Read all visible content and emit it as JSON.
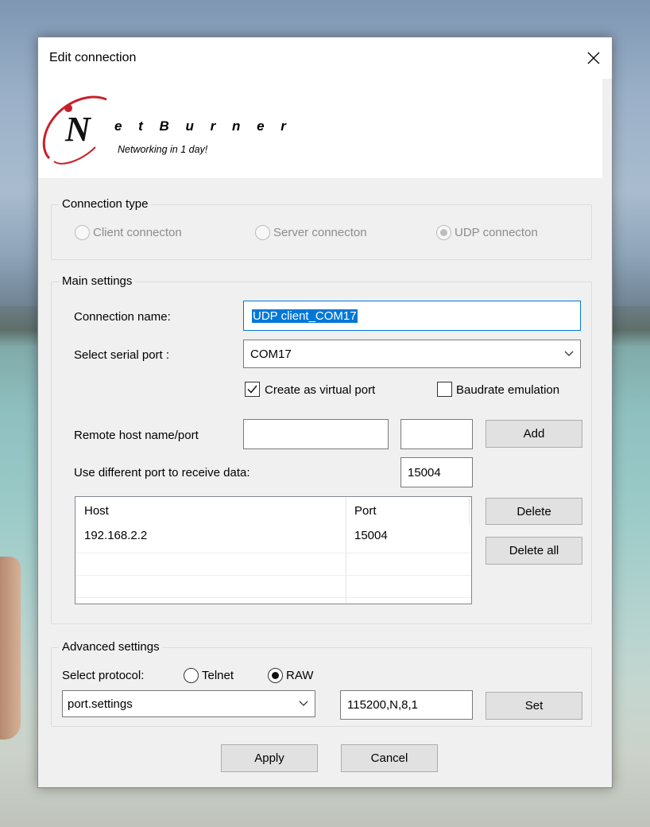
{
  "dialog": {
    "title": "Edit connection",
    "logo": {
      "wordmark": "e t B u r n e r",
      "letter": "N",
      "tagline": "Networking in 1 day!"
    }
  },
  "connection_type": {
    "legend": "Connection type",
    "options": [
      {
        "label": "Client connecton",
        "selected": false,
        "enabled": false
      },
      {
        "label": "Server connecton",
        "selected": false,
        "enabled": false
      },
      {
        "label": "UDP connecton",
        "selected": true,
        "enabled": false
      }
    ]
  },
  "main_settings": {
    "legend": "Main settings",
    "connection_name_label": "Connection name:",
    "connection_name_value": "UDP client_COM17",
    "serial_port_label": "Select serial port :",
    "serial_port_value": "COM17",
    "virtual_port_label": "Create as virtual port",
    "virtual_port_checked": true,
    "baudrate_label": "Baudrate emulation",
    "baudrate_checked": false,
    "remote_host_label": "Remote host name/port",
    "remote_host_value": "",
    "remote_port_value": "",
    "add_label": "Add",
    "diff_port_label": "Use different port to receive data:",
    "diff_port_value": "15004",
    "table": {
      "headers": [
        "Host",
        "Port"
      ],
      "rows": [
        [
          "192.168.2.2",
          "15004"
        ]
      ]
    },
    "delete_label": "Delete",
    "delete_all_label": "Delete all"
  },
  "advanced_settings": {
    "legend": "Advanced settings",
    "protocol_label": "Select protocol:",
    "protocols": [
      {
        "label": "Telnet",
        "selected": false
      },
      {
        "label": "RAW",
        "selected": true
      }
    ],
    "settings_combo_value": "port.settings",
    "settings_value": "115200,N,8,1",
    "set_label": "Set"
  },
  "footer": {
    "apply_label": "Apply",
    "cancel_label": "Cancel"
  },
  "colors": {
    "accent": "#0078d7",
    "logo_red": "#c8202a"
  }
}
